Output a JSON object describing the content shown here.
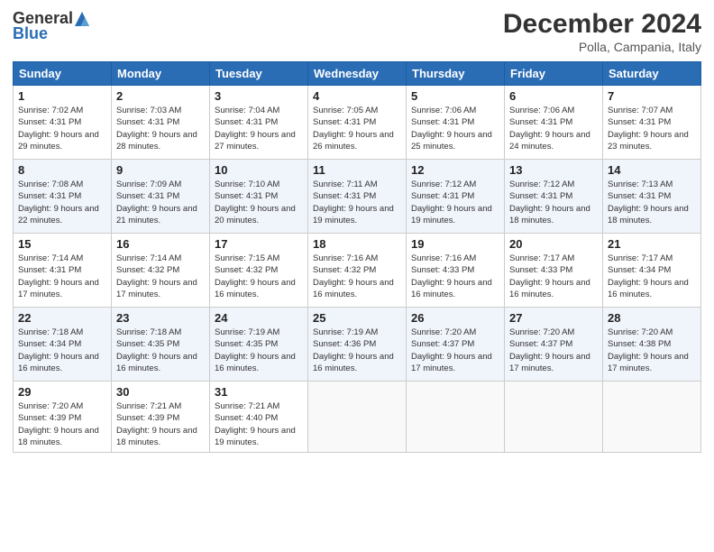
{
  "logo": {
    "general": "General",
    "blue": "Blue"
  },
  "title": "December 2024",
  "subtitle": "Polla, Campania, Italy",
  "days_header": [
    "Sunday",
    "Monday",
    "Tuesday",
    "Wednesday",
    "Thursday",
    "Friday",
    "Saturday"
  ],
  "weeks": [
    [
      {
        "num": "1",
        "sunrise": "7:02 AM",
        "sunset": "4:31 PM",
        "daylight": "9 hours and 29 minutes."
      },
      {
        "num": "2",
        "sunrise": "7:03 AM",
        "sunset": "4:31 PM",
        "daylight": "9 hours and 28 minutes."
      },
      {
        "num": "3",
        "sunrise": "7:04 AM",
        "sunset": "4:31 PM",
        "daylight": "9 hours and 27 minutes."
      },
      {
        "num": "4",
        "sunrise": "7:05 AM",
        "sunset": "4:31 PM",
        "daylight": "9 hours and 26 minutes."
      },
      {
        "num": "5",
        "sunrise": "7:06 AM",
        "sunset": "4:31 PM",
        "daylight": "9 hours and 25 minutes."
      },
      {
        "num": "6",
        "sunrise": "7:06 AM",
        "sunset": "4:31 PM",
        "daylight": "9 hours and 24 minutes."
      },
      {
        "num": "7",
        "sunrise": "7:07 AM",
        "sunset": "4:31 PM",
        "daylight": "9 hours and 23 minutes."
      }
    ],
    [
      {
        "num": "8",
        "sunrise": "7:08 AM",
        "sunset": "4:31 PM",
        "daylight": "9 hours and 22 minutes."
      },
      {
        "num": "9",
        "sunrise": "7:09 AM",
        "sunset": "4:31 PM",
        "daylight": "9 hours and 21 minutes."
      },
      {
        "num": "10",
        "sunrise": "7:10 AM",
        "sunset": "4:31 PM",
        "daylight": "9 hours and 20 minutes."
      },
      {
        "num": "11",
        "sunrise": "7:11 AM",
        "sunset": "4:31 PM",
        "daylight": "9 hours and 19 minutes."
      },
      {
        "num": "12",
        "sunrise": "7:12 AM",
        "sunset": "4:31 PM",
        "daylight": "9 hours and 19 minutes."
      },
      {
        "num": "13",
        "sunrise": "7:12 AM",
        "sunset": "4:31 PM",
        "daylight": "9 hours and 18 minutes."
      },
      {
        "num": "14",
        "sunrise": "7:13 AM",
        "sunset": "4:31 PM",
        "daylight": "9 hours and 18 minutes."
      }
    ],
    [
      {
        "num": "15",
        "sunrise": "7:14 AM",
        "sunset": "4:31 PM",
        "daylight": "9 hours and 17 minutes."
      },
      {
        "num": "16",
        "sunrise": "7:14 AM",
        "sunset": "4:32 PM",
        "daylight": "9 hours and 17 minutes."
      },
      {
        "num": "17",
        "sunrise": "7:15 AM",
        "sunset": "4:32 PM",
        "daylight": "9 hours and 16 minutes."
      },
      {
        "num": "18",
        "sunrise": "7:16 AM",
        "sunset": "4:32 PM",
        "daylight": "9 hours and 16 minutes."
      },
      {
        "num": "19",
        "sunrise": "7:16 AM",
        "sunset": "4:33 PM",
        "daylight": "9 hours and 16 minutes."
      },
      {
        "num": "20",
        "sunrise": "7:17 AM",
        "sunset": "4:33 PM",
        "daylight": "9 hours and 16 minutes."
      },
      {
        "num": "21",
        "sunrise": "7:17 AM",
        "sunset": "4:34 PM",
        "daylight": "9 hours and 16 minutes."
      }
    ],
    [
      {
        "num": "22",
        "sunrise": "7:18 AM",
        "sunset": "4:34 PM",
        "daylight": "9 hours and 16 minutes."
      },
      {
        "num": "23",
        "sunrise": "7:18 AM",
        "sunset": "4:35 PM",
        "daylight": "9 hours and 16 minutes."
      },
      {
        "num": "24",
        "sunrise": "7:19 AM",
        "sunset": "4:35 PM",
        "daylight": "9 hours and 16 minutes."
      },
      {
        "num": "25",
        "sunrise": "7:19 AM",
        "sunset": "4:36 PM",
        "daylight": "9 hours and 16 minutes."
      },
      {
        "num": "26",
        "sunrise": "7:20 AM",
        "sunset": "4:37 PM",
        "daylight": "9 hours and 17 minutes."
      },
      {
        "num": "27",
        "sunrise": "7:20 AM",
        "sunset": "4:37 PM",
        "daylight": "9 hours and 17 minutes."
      },
      {
        "num": "28",
        "sunrise": "7:20 AM",
        "sunset": "4:38 PM",
        "daylight": "9 hours and 17 minutes."
      }
    ],
    [
      {
        "num": "29",
        "sunrise": "7:20 AM",
        "sunset": "4:39 PM",
        "daylight": "9 hours and 18 minutes."
      },
      {
        "num": "30",
        "sunrise": "7:21 AM",
        "sunset": "4:39 PM",
        "daylight": "9 hours and 18 minutes."
      },
      {
        "num": "31",
        "sunrise": "7:21 AM",
        "sunset": "4:40 PM",
        "daylight": "9 hours and 19 minutes."
      },
      null,
      null,
      null,
      null
    ]
  ]
}
